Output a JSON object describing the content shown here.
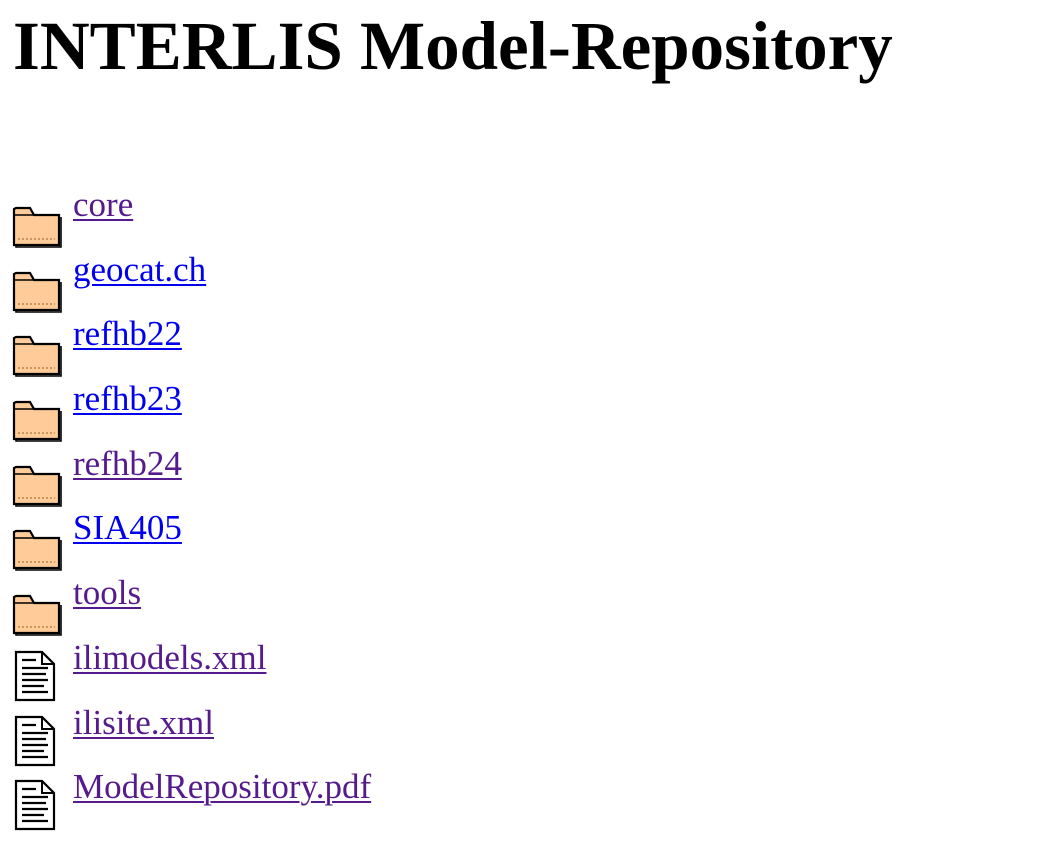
{
  "page": {
    "title": "INTERLIS Model-Repository"
  },
  "colors": {
    "visited_link": "#551a8b",
    "unvisited_link": "#0000ee",
    "folder_fill": "#ffcc99",
    "folder_outline": "#000000"
  },
  "listing": {
    "entries": [
      {
        "label": "core",
        "icon": "folder-icon",
        "state": "visited"
      },
      {
        "label": "geocat.ch",
        "icon": "folder-icon",
        "state": "unvisited"
      },
      {
        "label": "refhb22",
        "icon": "folder-icon",
        "state": "unvisited"
      },
      {
        "label": "refhb23",
        "icon": "folder-icon",
        "state": "unvisited"
      },
      {
        "label": "refhb24",
        "icon": "folder-icon",
        "state": "visited"
      },
      {
        "label": "SIA405",
        "icon": "folder-icon",
        "state": "unvisited"
      },
      {
        "label": "tools",
        "icon": "folder-icon",
        "state": "visited"
      },
      {
        "label": "ilimodels.xml",
        "icon": "text-file-icon",
        "state": "visited"
      },
      {
        "label": "ilisite.xml",
        "icon": "text-file-icon",
        "state": "visited"
      },
      {
        "label": "ModelRepository.pdf",
        "icon": "text-file-icon",
        "state": "visited"
      }
    ]
  }
}
